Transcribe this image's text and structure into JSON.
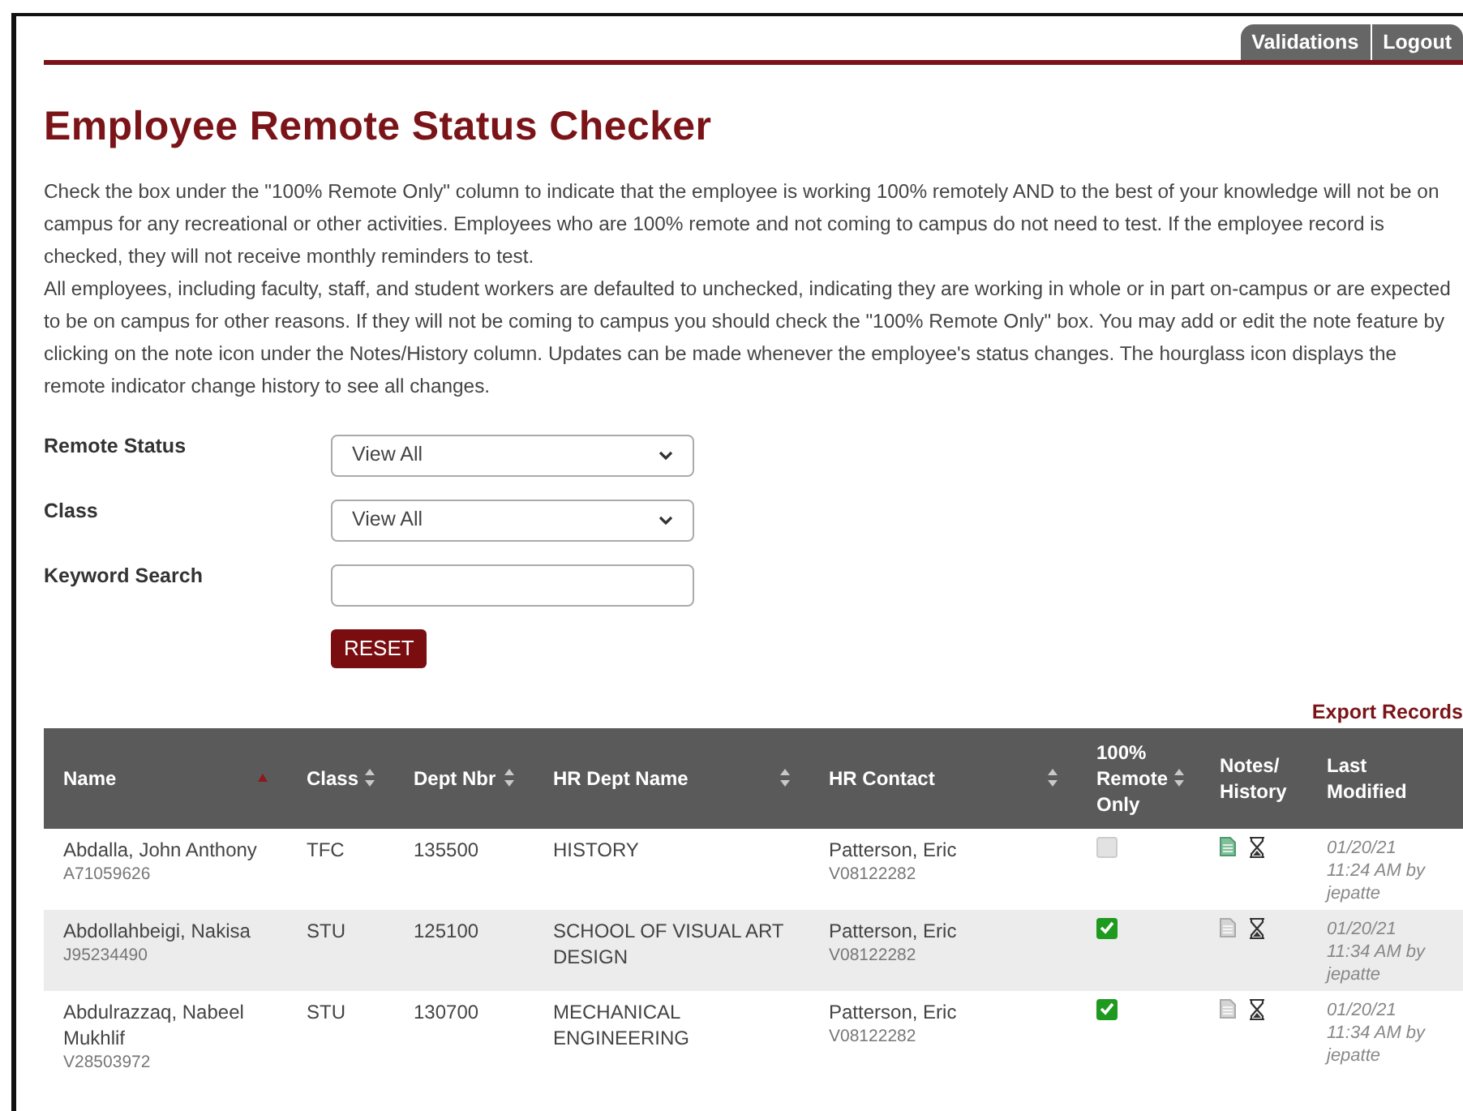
{
  "nav_tabs": [
    {
      "label": "Validations"
    },
    {
      "label": "Logout"
    }
  ],
  "title": "Employee Remote Status Checker",
  "instructions": [
    "Check the box under the \"100% Remote Only\" column to indicate that the employee is working 100% remotely AND to the best of your knowledge will not be on campus for any recreational or other activities. Employees who are 100% remote and not coming to campus do not need to test. If the employee record is checked, they will not receive monthly reminders to test.",
    "All employees, including faculty, staff, and student workers are defaulted to unchecked, indicating they are working in whole or in part on-campus or are expected to be on campus for other reasons. If they will not be coming to campus you should check the \"100% Remote Only\" box. You may add or edit the note feature by clicking on the note icon under the Notes/History column. Updates can be made whenever the employee's status changes. The hourglass icon displays the remote indicator change history to see all changes."
  ],
  "filters": [
    {
      "label": "Remote Status",
      "kind": "select",
      "value": "View All"
    },
    {
      "label": "Class",
      "kind": "select",
      "value": "View All"
    },
    {
      "label": "Keyword Search",
      "kind": "text"
    }
  ],
  "reset_button": "RESET",
  "export_link": "Export Records",
  "table": {
    "columns": [
      {
        "label": "Name",
        "sortable": true,
        "sorted_ascending": true
      },
      {
        "label": "Class",
        "sortable": true,
        "sorted_ascending": false
      },
      {
        "label": "Dept Nbr",
        "sortable": true,
        "sorted_ascending": false
      },
      {
        "label": "HR Dept Name",
        "sortable": true,
        "sorted_ascending": false
      },
      {
        "label": "HR Contact",
        "sortable": true,
        "sorted_ascending": false
      },
      {
        "label": "100% Remote Only",
        "sortable": true,
        "sorted_ascending": false
      },
      {
        "label": "Notes/ History",
        "sortable": false
      },
      {
        "label": "Last Modified",
        "sortable": false
      }
    ],
    "rows": [
      {
        "name": "Abdalla, John Anthony",
        "id": "A71059626",
        "class": "TFC",
        "dept_nbr": "135500",
        "hr_dept_name": "HISTORY",
        "hr_contact": "Patterson, Eric",
        "hr_contact_id": "V08122282",
        "remote_only": false,
        "has_note": true,
        "last_modified": "01/20/21 11:24 AM by jepatte"
      },
      {
        "name": "Abdollahbeigi, Nakisa",
        "id": "J95234490",
        "class": "STU",
        "dept_nbr": "125100",
        "hr_dept_name": "SCHOOL OF VISUAL ART DESIGN",
        "hr_contact": "Patterson, Eric",
        "hr_contact_id": "V08122282",
        "remote_only": true,
        "has_note": false,
        "last_modified": "01/20/21 11:34 AM by jepatte"
      },
      {
        "name": "Abdulrazzaq, Nabeel Mukhlif",
        "id": "V28503972",
        "class": "STU",
        "dept_nbr": "130700",
        "hr_dept_name": "MECHANICAL ENGINEERING",
        "hr_contact": "Patterson, Eric",
        "hr_contact_id": "V08122282",
        "remote_only": true,
        "has_note": false,
        "last_modified": "01/20/21 11:34 AM by jepatte"
      }
    ]
  }
}
